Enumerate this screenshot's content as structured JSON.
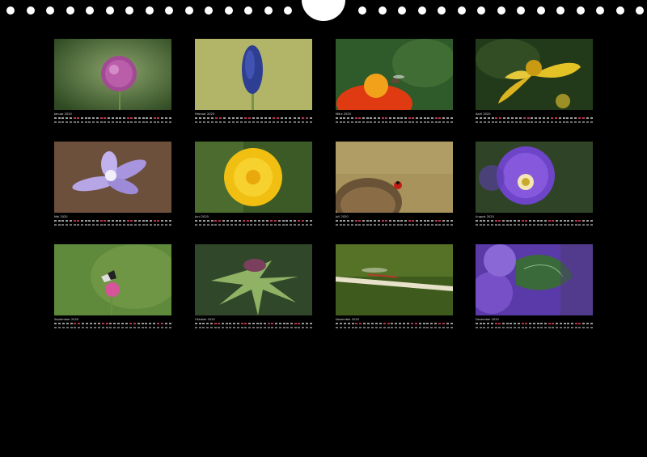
{
  "calendar": {
    "months": [
      {
        "label": "Januar 2020",
        "days": 31,
        "photo": "allium-flower"
      },
      {
        "label": "Februar 2020",
        "days": 29,
        "photo": "grape-hyacinth"
      },
      {
        "label": "März 2020",
        "days": 31,
        "photo": "orange-flower-bee"
      },
      {
        "label": "April 2020",
        "days": 30,
        "photo": "yellow-flower"
      },
      {
        "label": "Mai 2020",
        "days": 31,
        "photo": "hepatica-flower"
      },
      {
        "label": "Juni 2020",
        "days": 30,
        "photo": "dandelion"
      },
      {
        "label": "Juli 2020",
        "days": 31,
        "photo": "teasel-ladybug"
      },
      {
        "label": "August 2020",
        "days": 31,
        "photo": "anemone-flower"
      },
      {
        "label": "September 2020",
        "days": 30,
        "photo": "butterfly-thistle"
      },
      {
        "label": "Oktober 2020",
        "days": 31,
        "photo": "milk-thistle"
      },
      {
        "label": "November 2020",
        "days": 30,
        "photo": "damselfly-stem"
      },
      {
        "label": "Dezember 2020",
        "days": 31,
        "photo": "campanula-leaf"
      }
    ]
  },
  "colors": {
    "background": "#000000",
    "weekend": "#b3354a",
    "binding": "#ffffff"
  }
}
